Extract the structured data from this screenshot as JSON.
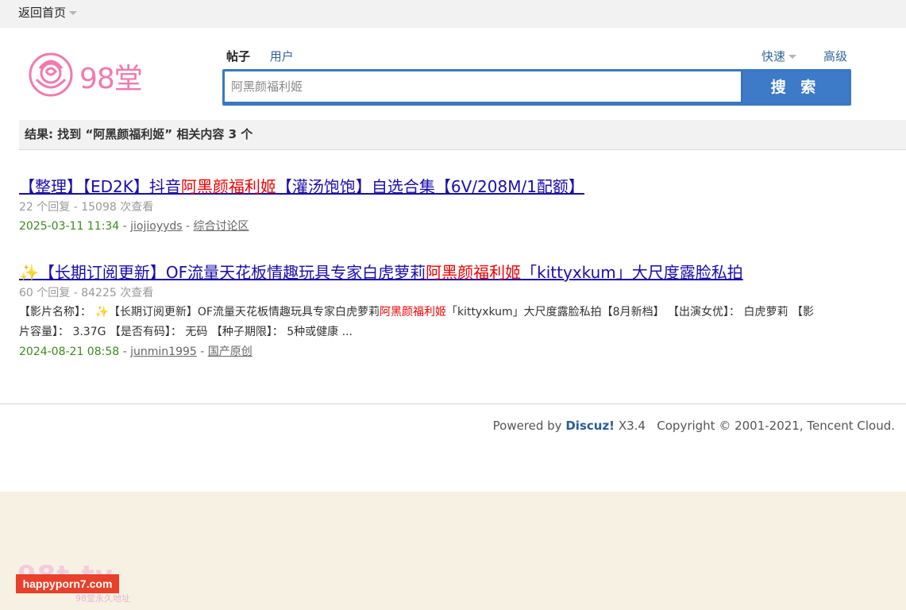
{
  "topbar": {
    "home_label": "返回首页"
  },
  "header": {
    "logo_text": "98堂",
    "tabs": [
      {
        "label": "帖子",
        "active": true
      },
      {
        "label": "用户",
        "active": false
      }
    ],
    "quick_label": "快速",
    "advanced_label": "高级"
  },
  "search": {
    "value": "阿黑颜福利姬",
    "button_label": "搜 索"
  },
  "result_summary": "结果: 找到 “阿黑颜福利姬” 相关内容 3 个",
  "results": [
    {
      "title_before": "【整理】【ED2K】抖音",
      "title_highlight": "阿黑颜福利姬",
      "title_after": "【灌汤饱饱】自选合集【6V/208M/1配额】",
      "stats": "22 个回复 - 15098 次查看",
      "snippet_before": "",
      "snippet_highlight": "",
      "snippet_after": "",
      "date": "2025-03-11 11:34",
      "author": "jiojioyyds",
      "forum": "综合讨论区"
    },
    {
      "title_before": "✨【长期订阅更新】OF流量天花板情趣玩具专家白虎萝莉",
      "title_highlight": "阿黑颜福利姬",
      "title_after": "「kittyxkum」大尺度露脸私拍",
      "stats": "60 个回复 - 84225 次查看",
      "snippet_before": "【影片名称】： ✨【长期订阅更新】OF流量天花板情趣玩具专家白虎萝莉",
      "snippet_highlight": "阿黑颜福利姬",
      "snippet_after": "「kittyxkum」大尺度露脸私拍【8月新档】 【出演女优】： 白虎萝莉 【影片容量】： 3.37G 【是否有码】： 无码 【种子期限】： 5种或健康 ...",
      "date": "2024-08-21 08:58",
      "author": "junmin1995",
      "forum": "国产原创"
    }
  ],
  "footer": {
    "powered_prefix": "Powered by",
    "powered_brand": "Discuz!",
    "version": "X3.4",
    "copyright": "Copyright © 2001-2021, Tencent Cloud."
  },
  "watermark": {
    "site": "98t.tv",
    "badge": "happyporn7.com",
    "sub": "98堂永久地址"
  },
  "colors": {
    "accent_blue": "#3a78c3",
    "highlight_red": "#ee0000",
    "link_blue": "#1a0dab",
    "date_green": "#3c8a1e",
    "logo_pink": "#f07ab0"
  }
}
